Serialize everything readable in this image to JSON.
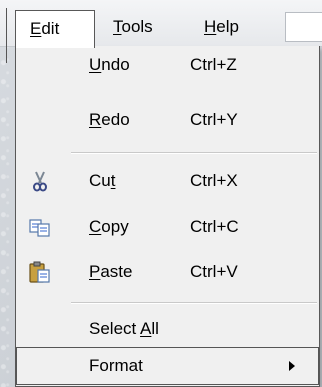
{
  "menubar": {
    "edit": {
      "label": "Edit",
      "mnemonic": "E",
      "rest": "dit"
    },
    "tools": {
      "label": "Tools",
      "mnemonic": "T",
      "rest": "ools"
    },
    "help": {
      "label": "Help",
      "mnemonic": "H",
      "rest": "elp"
    }
  },
  "edit_menu": {
    "undo": {
      "pre": "",
      "mnemonic": "U",
      "post": "ndo",
      "shortcut": "Ctrl+Z"
    },
    "redo": {
      "pre": "",
      "mnemonic": "R",
      "post": "edo",
      "shortcut": "Ctrl+Y"
    },
    "cut": {
      "pre": "Cu",
      "mnemonic": "t",
      "post": "",
      "shortcut": "Ctrl+X",
      "icon": "scissors-icon"
    },
    "copy": {
      "pre": "",
      "mnemonic": "C",
      "post": "opy",
      "shortcut": "Ctrl+C",
      "icon": "copy-icon"
    },
    "paste": {
      "pre": "",
      "mnemonic": "P",
      "post": "aste",
      "shortcut": "Ctrl+V",
      "icon": "paste-icon"
    },
    "select_all": {
      "pre": "Select ",
      "mnemonic": "A",
      "post": "ll"
    },
    "format": {
      "label": "Format"
    }
  }
}
